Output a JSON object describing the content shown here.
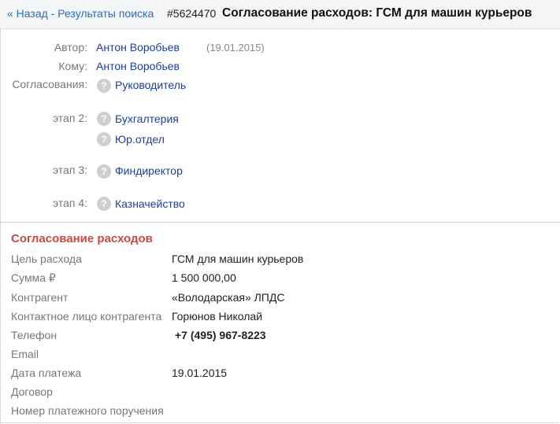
{
  "header": {
    "back_label": "« Назад - Результаты поиска",
    "doc_number": "#5624470",
    "title": "Согласование расходов: ГСМ для машин курьеров"
  },
  "approval": {
    "author_label": "Автор:",
    "author_name": "Антон Воробьев",
    "author_date": "(19.01.2015)",
    "to_label": "Кому:",
    "to_name": "Антон Воробьев",
    "approvals_label": "Согласования:",
    "stages": [
      {
        "label": "",
        "items": [
          "Руководитель"
        ]
      },
      {
        "label": "этап 2:",
        "items": [
          "Бухгалтерия",
          "Юр.отдел"
        ]
      },
      {
        "label": "этап 3:",
        "items": [
          "Финдиректор"
        ]
      },
      {
        "label": "этап 4:",
        "items": [
          "Казначейство"
        ]
      }
    ],
    "status_icon": "question-icon",
    "status_glyph": "?"
  },
  "details": {
    "section_title": "Согласование расходов",
    "fields": [
      {
        "label": "Цель расхода",
        "value": "ГСМ для машин курьеров"
      },
      {
        "label": "Сумма ₽",
        "value": "1 500 000,00"
      },
      {
        "label": "Контрагент",
        "value": "«Володарская» ЛПДС"
      },
      {
        "label": "Контактное лицо контрагента",
        "value": "Горюнов Николай"
      },
      {
        "label": "Телефон",
        "value": "+7 (495) 967-8223"
      },
      {
        "label": "Email",
        "value": ""
      },
      {
        "label": "Дата платежа",
        "value": "19.01.2015"
      },
      {
        "label": "Договор",
        "value": ""
      },
      {
        "label": "Номер платежного поручения",
        "value": ""
      }
    ]
  },
  "colors": {
    "link": "#1a3f9e",
    "back_link": "#2a6ebb",
    "section_title": "#c94a3f",
    "label": "#777777",
    "icon": "#cfcfcf"
  }
}
